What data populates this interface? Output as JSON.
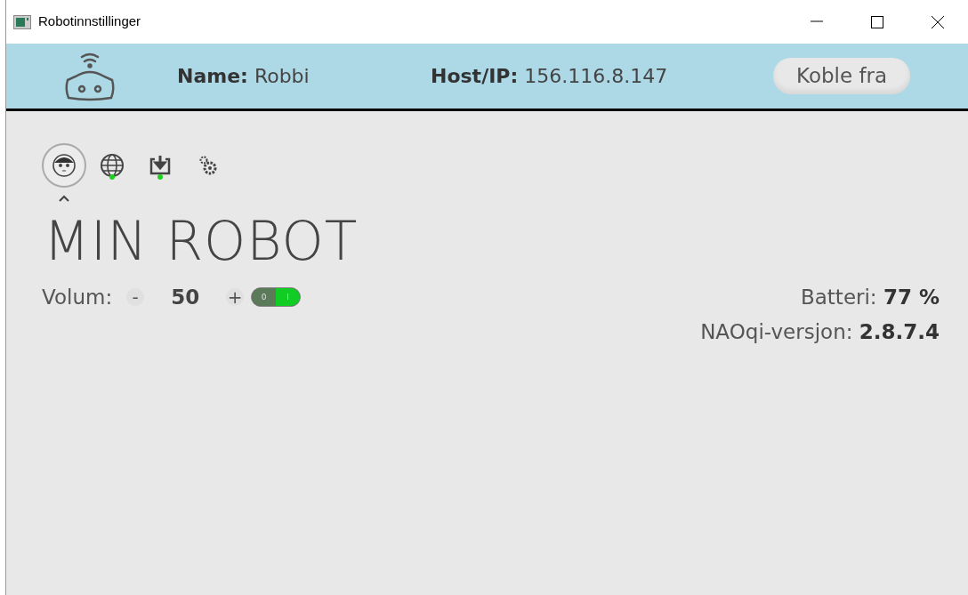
{
  "window": {
    "title": "Robotinnstillinger"
  },
  "header": {
    "name_label": "Name:",
    "name_value": "Robbi",
    "host_label": "Host/IP:",
    "host_value": "156.116.8.147",
    "disconnect_button": "Koble fra"
  },
  "tabs": [
    {
      "kind": "robot",
      "selected": true,
      "online": false
    },
    {
      "kind": "globe",
      "selected": false,
      "online": true
    },
    {
      "kind": "download",
      "selected": false,
      "online": true
    },
    {
      "kind": "gears",
      "selected": false,
      "online": false
    }
  ],
  "title": "MIN ROBOT",
  "volume": {
    "label": "Volum:",
    "minus": "-",
    "value": "50",
    "plus": "+",
    "toggle": {
      "on": true,
      "off_label": "0",
      "on_label": "I"
    }
  },
  "info": [
    {
      "label": "Batteri:",
      "value": "77 %"
    },
    {
      "label": "NAOqi-versjon:",
      "value": "2.8.7.4"
    }
  ]
}
